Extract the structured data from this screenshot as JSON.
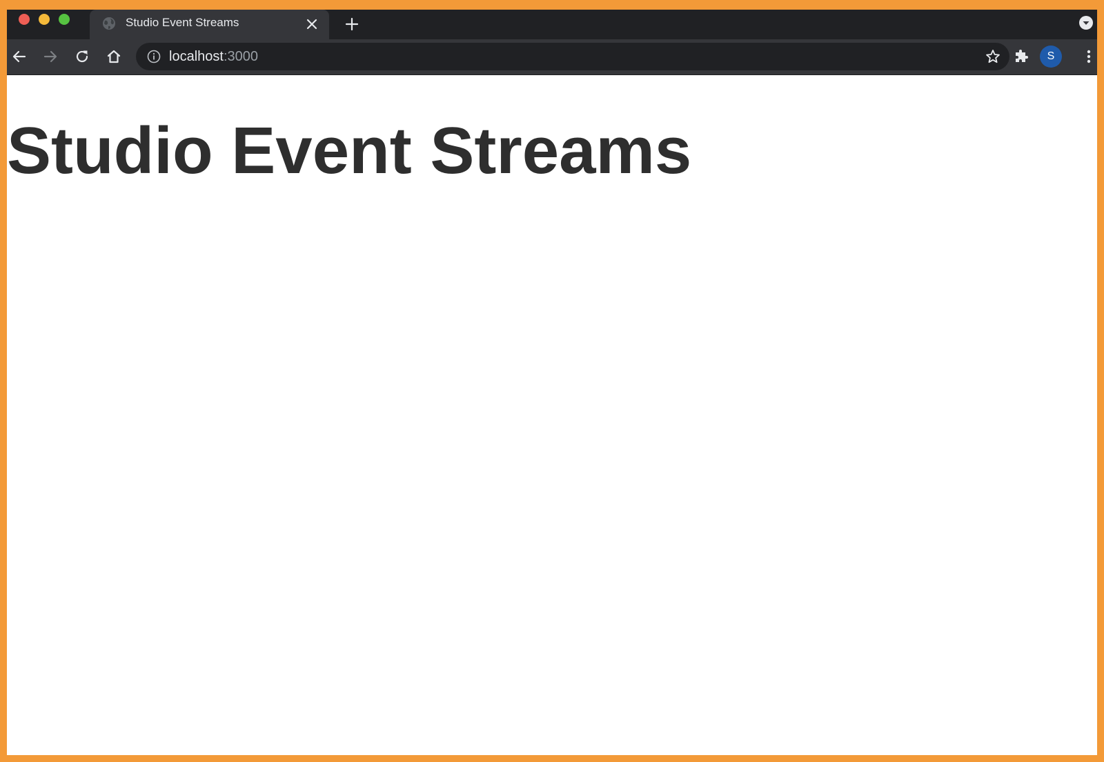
{
  "browser": {
    "tab": {
      "title": "Studio Event Streams",
      "favicon": "globe-icon",
      "close_icon": "close-icon"
    },
    "new_tab_icon": "plus-icon",
    "tab_search_icon": "chevron-down-icon",
    "toolbar": {
      "back_icon": "arrow-left-icon",
      "forward_icon": "arrow-right-icon",
      "reload_icon": "reload-icon",
      "home_icon": "home-icon",
      "extensions_icon": "puzzle-icon",
      "menu_icon": "kebab-menu-icon"
    },
    "address_bar": {
      "host": "localhost",
      "port": ":3000",
      "info_icon": "info-icon",
      "bookmark_icon": "star-icon"
    },
    "profile": {
      "initial": "S",
      "color": "#1f5bab"
    }
  },
  "page": {
    "heading": "Studio Event Streams"
  },
  "colors": {
    "frame_border": "#f39a38",
    "chrome_dark": "#202124",
    "chrome_toolbar": "#35363a",
    "heading_text": "#2e2e2e"
  }
}
